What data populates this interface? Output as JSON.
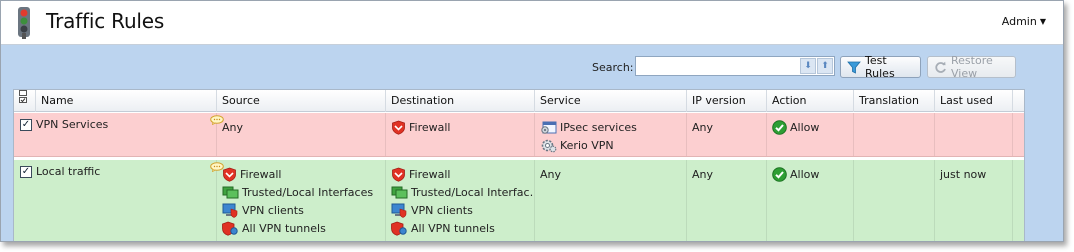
{
  "app": {
    "title": "Traffic Rules",
    "user_menu": "Admin"
  },
  "toolbar": {
    "search_label": "Search:",
    "search_value": "",
    "test_rules_label": "Test Rules",
    "restore_view_label": "Restore View"
  },
  "table": {
    "columns": [
      "Name",
      "Source",
      "Destination",
      "Service",
      "IP version",
      "Action",
      "Translation",
      "Last used"
    ],
    "rows": [
      {
        "name": "VPN Services",
        "enabled": true,
        "color": "#fccfd0",
        "source": [
          "Any"
        ],
        "destination": [
          "Firewall"
        ],
        "service": [
          "IPsec services",
          "Kerio VPN"
        ],
        "ip_version": "Any",
        "action": "Allow",
        "translation": "",
        "last_used": ""
      },
      {
        "name": "Local traffic",
        "enabled": true,
        "color": "#cdeecb",
        "source": [
          "Firewall",
          "Trusted/Local Interfaces",
          "VPN clients",
          "All VPN tunnels"
        ],
        "destination": [
          "Firewall",
          "Trusted/Local Interfac…",
          "VPN clients",
          "All VPN tunnels"
        ],
        "service": [
          "Any"
        ],
        "ip_version": "Any",
        "action": "Allow",
        "translation": "",
        "last_used": "just now"
      }
    ]
  }
}
